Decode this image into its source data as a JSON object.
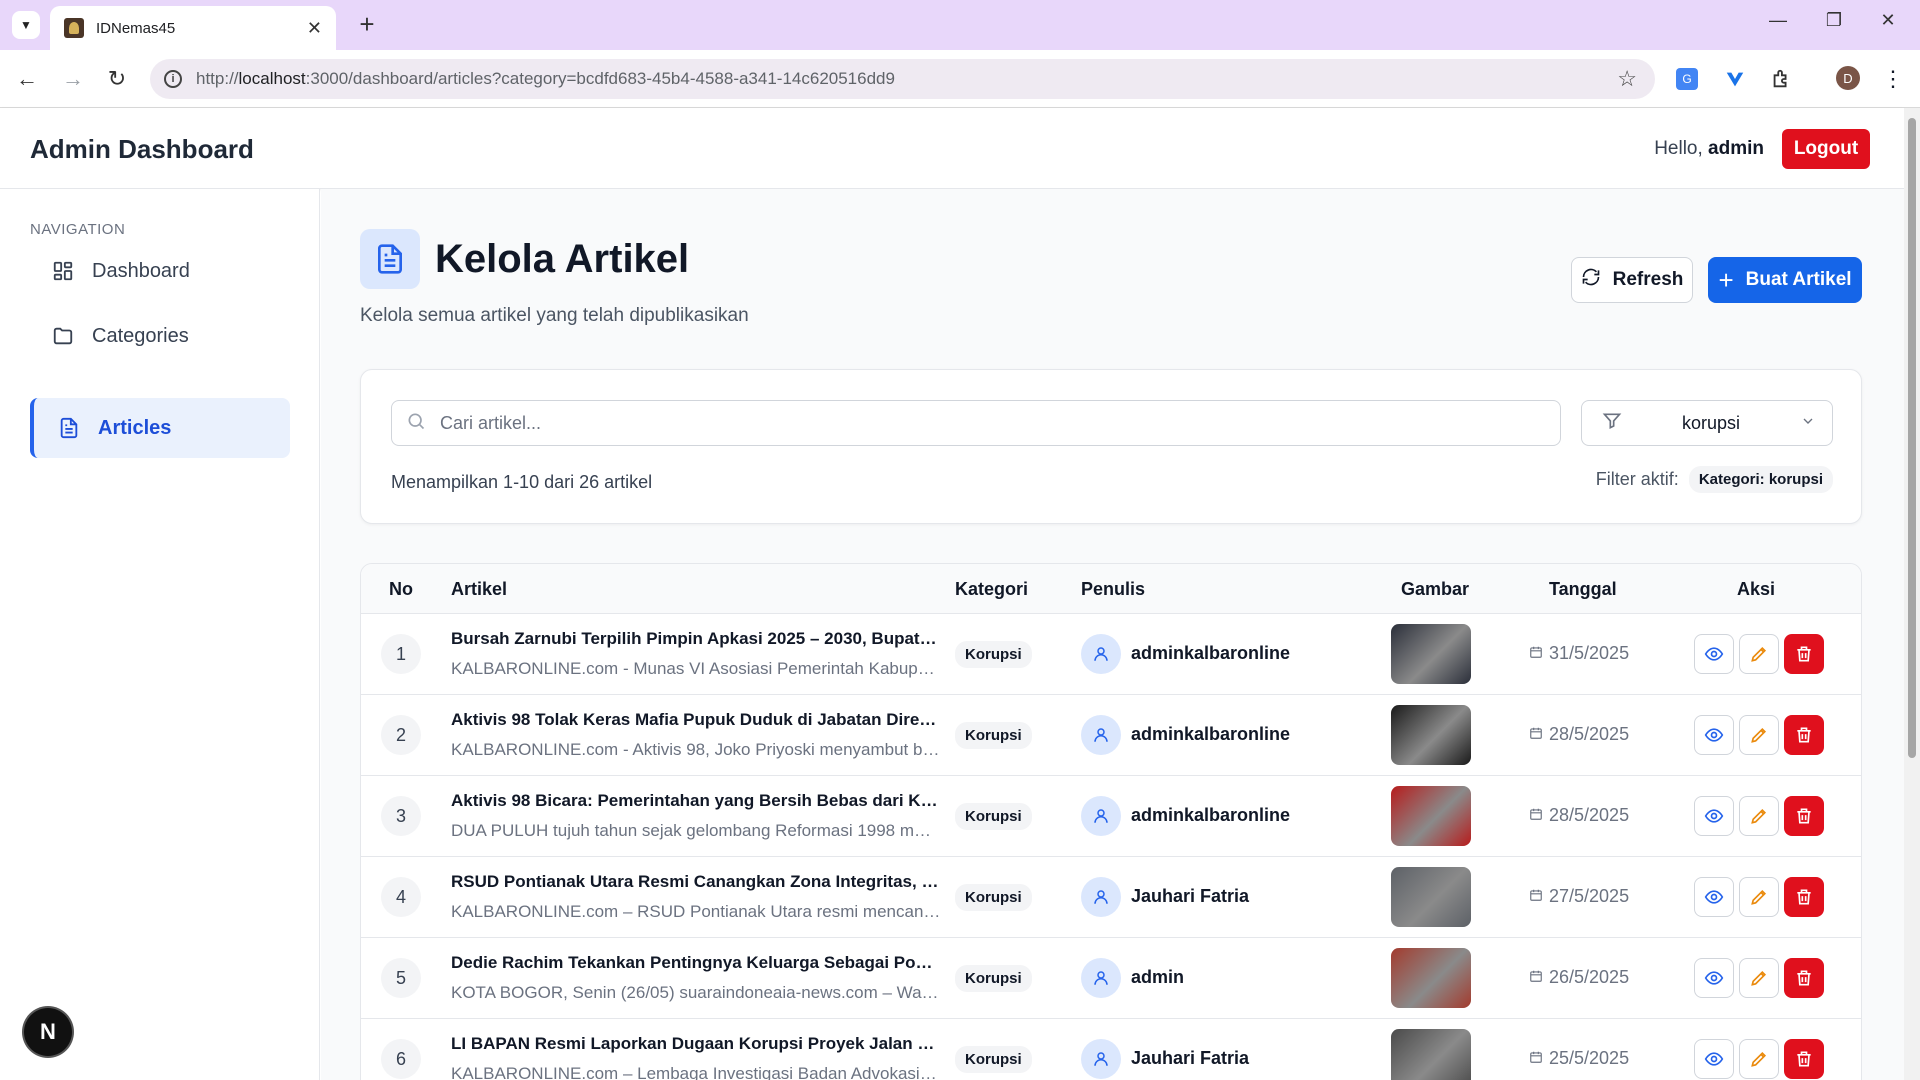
{
  "browser": {
    "tab_title": "IDNemas45",
    "url_prefix": "http://",
    "url_host": "localhost",
    "url_rest": ":3000/dashboard/articles?category=bcdfd683-45b4-4588-a341-14c620516dd9",
    "profile_initial": "D"
  },
  "header": {
    "title": "Admin Dashboard",
    "hello_prefix": "Hello,",
    "username": "admin",
    "logout_label": "Logout"
  },
  "sidebar": {
    "heading": "NAVIGATION",
    "items": [
      {
        "label": "Dashboard",
        "icon": "dashboard-icon"
      },
      {
        "label": "Categories",
        "icon": "folder-icon"
      },
      {
        "label": "Articles",
        "icon": "document-icon",
        "active": true
      }
    ]
  },
  "page": {
    "title": "Kelola Artikel",
    "subtitle": "Kelola semua artikel yang telah dipublikasikan",
    "refresh_label": "Refresh",
    "create_label": "Buat Artikel"
  },
  "filters": {
    "search_placeholder": "Cari artikel...",
    "category_value": "korupsi",
    "count_text": "Menampilkan 1-10 dari 26 artikel",
    "active_label": "Filter aktif:",
    "active_chip": "Kategori: korupsi"
  },
  "table": {
    "columns": [
      "No",
      "Artikel",
      "Kategori",
      "Penulis",
      "Gambar",
      "Tanggal",
      "Aksi"
    ],
    "rows": [
      {
        "no": "1",
        "title": "Bursah Zarnubi Terpilih Pimpin Apkasi 2025 – 2030, Bupati …",
        "excerpt": "KALBARONLINE.com - Munas VI Asosiasi Pemerintah Kabupa…",
        "category": "Korupsi",
        "author": "adminkalbaronline",
        "date": "31/5/2025",
        "thumb_color": "#2b2f3a"
      },
      {
        "no": "2",
        "title": "Aktivis 98 Tolak Keras Mafia Pupuk Duduk di Jabatan Direk…",
        "excerpt": "KALBARONLINE.com - Aktivis 98, Joko Priyoski menyambut b…",
        "category": "Korupsi",
        "author": "adminkalbaronline",
        "date": "28/5/2025",
        "thumb_color": "#1a1a1a"
      },
      {
        "no": "3",
        "title": "Aktivis 98 Bicara: Pemerintahan yang Bersih Bebas dari KK…",
        "excerpt": "DUA PULUH tujuh tahun sejak gelombang Reformasi 1998 m…",
        "category": "Korupsi",
        "author": "adminkalbaronline",
        "date": "28/5/2025",
        "thumb_color": "#b71c1c"
      },
      {
        "no": "4",
        "title": "RSUD Pontianak Utara Resmi Canangkan Zona Integritas, T…",
        "excerpt": "KALBARONLINE.com – RSUD Pontianak Utara resmi mencana…",
        "category": "Korupsi",
        "author": "Jauhari Fatria",
        "date": "27/5/2025",
        "thumb_color": "#5d6167"
      },
      {
        "no": "5",
        "title": "Dedie Rachim Tekankan Pentingnya Keluarga Sebagai Pon…",
        "excerpt": "KOTA BOGOR, Senin (26/05) suaraindoneaia-news.com – Wal…",
        "category": "Korupsi",
        "author": "admin",
        "date": "26/5/2025",
        "thumb_color": "#a33b2e"
      },
      {
        "no": "6",
        "title": "LI BAPAN Resmi Laporkan Dugaan Korupsi Proyek Jalan Na…",
        "excerpt": "KALBARONLINE.com – Lembaga Investigasi Badan Advokasi…",
        "category": "Korupsi",
        "author": "Jauhari Fatria",
        "date": "25/5/2025",
        "thumb_color": "#4a4a4a"
      }
    ]
  },
  "colors": {
    "primary": "#1565e8",
    "danger": "#e0101d",
    "active_nav_bg": "#eaf1fd"
  },
  "floating_badge": "N"
}
